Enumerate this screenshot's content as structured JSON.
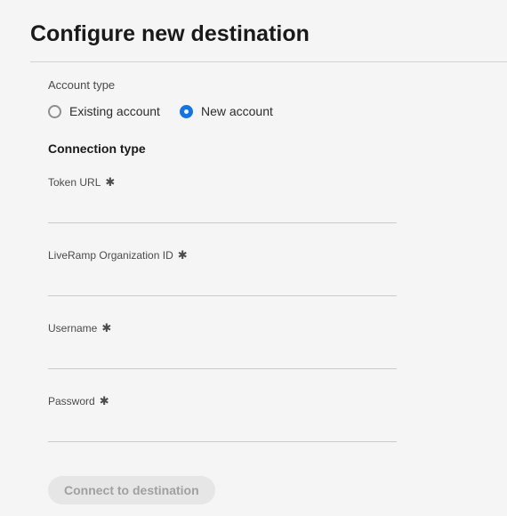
{
  "page": {
    "title": "Configure new destination"
  },
  "account_type": {
    "label": "Account type",
    "options": {
      "existing": "Existing account",
      "new": "New account"
    },
    "selected": "new"
  },
  "connection_type": {
    "title": "Connection type",
    "fields": {
      "token_url": {
        "label": "Token URL",
        "value": ""
      },
      "liveramp_org_id": {
        "label": "LiveRamp Organization ID",
        "value": ""
      },
      "username": {
        "label": "Username",
        "value": ""
      },
      "password": {
        "label": "Password",
        "value": ""
      }
    }
  },
  "actions": {
    "connect": "Connect to destination"
  },
  "icons": {
    "required": "✱"
  }
}
